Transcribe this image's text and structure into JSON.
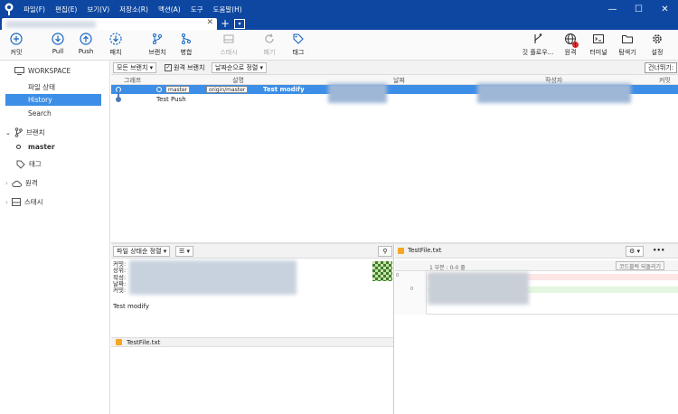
{
  "menu": [
    "파일(F)",
    "편집(E)",
    "보기(V)",
    "저장소(R)",
    "액션(A)",
    "도구",
    "도움말(H)"
  ],
  "window_controls": {
    "minimize": "—",
    "maximize": "☐",
    "close": "✕"
  },
  "tab": {
    "close": "✕",
    "add": "+",
    "menu": "▾"
  },
  "toolbar": {
    "commit": "커밋",
    "pull": "Pull",
    "push": "Push",
    "fetch": "패치",
    "branch": "브랜치",
    "merge": "병합",
    "stash": "스태시",
    "discard": "폐기",
    "tag": "태그",
    "git_flow": "깃 플로우...",
    "remote": "원격",
    "terminal": "터미널",
    "explorer": "탐색기",
    "settings": "설정",
    "remote_badge": "!"
  },
  "sidebar": {
    "workspace": "WORKSPACE",
    "workspace_items": [
      "파일 상태",
      "History",
      "Search"
    ],
    "active_item": "History",
    "branches_label": "브랜치",
    "branches": [
      "master"
    ],
    "tags_label": "태그",
    "remotes_label": "원격",
    "stashes_label": "스태시"
  },
  "graph_controls": {
    "branch_filter": "모든 브랜치 ▾",
    "show_remote": "원격 브랜치",
    "sort": "날짜순으로 정렬 ▾",
    "jump": "건너뛰기:"
  },
  "columns": [
    "그래프",
    "설명",
    "날짜",
    "작성자",
    "커밋"
  ],
  "commits": [
    {
      "refs": [
        "master",
        "origin/master"
      ],
      "message": "Test modify",
      "selected": true
    },
    {
      "refs": [],
      "message": "Test Push",
      "selected": false
    }
  ],
  "details": {
    "sort": "파일 상태순 정렬 ▾",
    "view_toggle": "☰ ▾",
    "search_icon": "⚲",
    "labels": [
      "커밋:",
      "상위:",
      "작성:",
      "날짜:",
      "커밋:"
    ],
    "message": "Test modify",
    "file": "TestFile.txt"
  },
  "diff": {
    "file": "TestFile.txt",
    "hunk": "1 부분 : 0-0 줄",
    "revert": "코드블럭 되돌리기",
    "gear": "⚙ ▾",
    "more": "•••",
    "line_old": "0",
    "line_new": "0"
  }
}
